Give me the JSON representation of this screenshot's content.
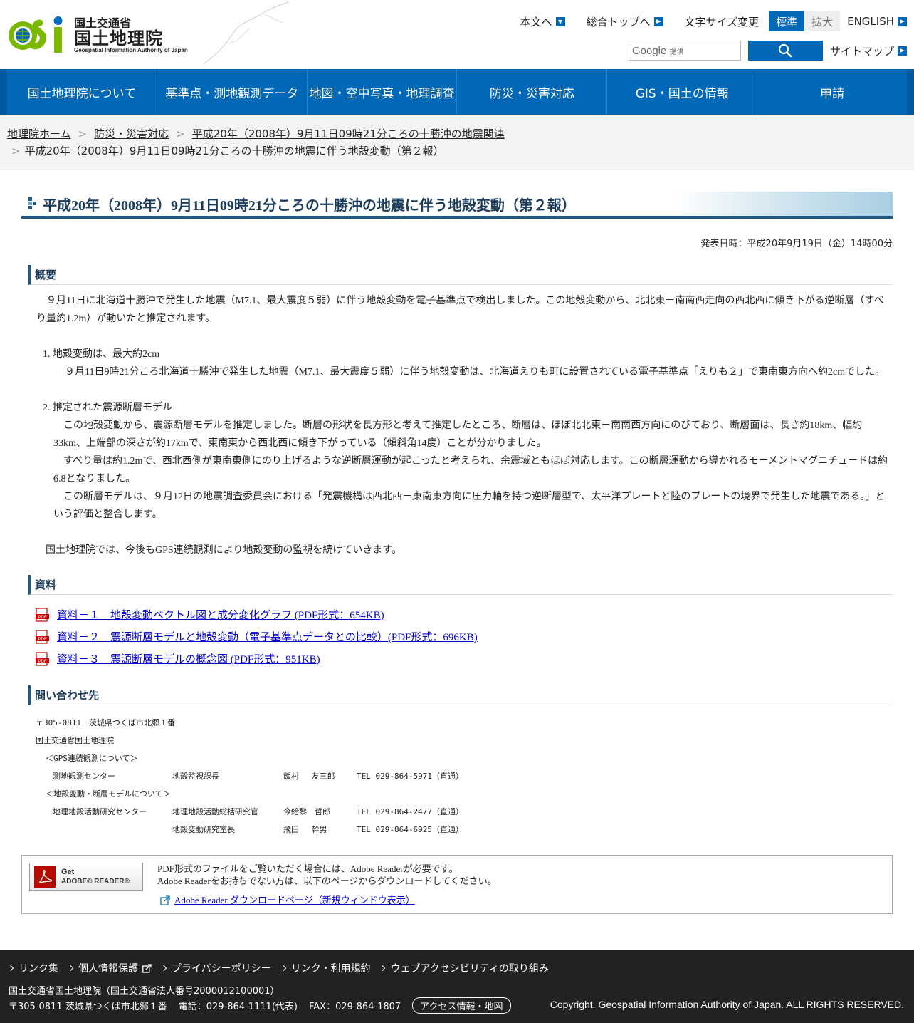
{
  "header": {
    "logo": {
      "org_small": "国土交通省",
      "org_main": "国土地理院",
      "org_en": "Geospatial Information Authority of Japan"
    },
    "links": {
      "to_content": "本文へ",
      "to_top": "総合トップへ",
      "font_size_label": "文字サイズ変更",
      "font_standard": "標準",
      "font_large": "拡大",
      "english": "ENGLISH",
      "sitemap": "サイトマップ"
    },
    "search": {
      "google": "Google",
      "provided": "提供"
    }
  },
  "gnav": [
    "国土地理院について",
    "基準点・測地観測データ",
    "地図・空中写真・地理調査",
    "防災・災害対応",
    "GIS・国土の情報",
    "申請"
  ],
  "breadcrumb": {
    "home": "地理院ホーム",
    "disaster": "防災・災害対応",
    "related": "平成20年（2008年）9月11日09時21分ころの十勝沖の地震関連",
    "current": "平成20年（2008年）9月11日09時21分ころの十勝沖の地震に伴う地殻変動（第２報）",
    "sep": ">"
  },
  "main": {
    "title": "平成20年（2008年）9月11日09時21分ころの十勝沖の地震に伴う地殻変動（第２報）",
    "pub_date": "発表日時：平成20年9月19日（金）14時00分",
    "summary_heading": "概要",
    "summary": "９月11日に北海道十勝沖で発生した地震（M7.1、最大震度５弱）に伴う地殻変動を電子基準点で検出しました。この地殻変動から、北北東－南南西走向の西北西に傾き下がる逆断層（すべり量約1.2m）が動いたと推定されます。",
    "item1_title": "1. 地殻変動は、最大約2cm",
    "item1_body": "９月11日9時21分ころ北海道十勝沖で発生した地震（M7.1、最大震度５弱）に伴う地殻変動は、北海道えりも町に設置されている電子基準点「えりも２」で東南東方向へ約2cmでした。",
    "item2_title": "2. 推定された震源断層モデル",
    "item2_p1": "この地殻変動から、震源断層モデルを推定しました。断層の形状を長方形と考えて推定したところ、断層は、ほぼ北北東－南南西方向にのびており、断層面は、長さ約18km、幅約33km、上端部の深さが約17kmで、東南東から西北西に傾き下がっている（傾斜角14度）ことが分かりました。",
    "item2_p2": "すべり量は約1.2mで、西北西側が東南東側にのり上げるような逆断層運動が起こったと考えられ、余震域ともほぼ対応します。この断層運動から導かれるモーメントマグニチュードは約6.8となりました。",
    "item2_p3": "この断層モデルは、９月12日の地震調査委員会における「発震機構は西北西－東南東方向に圧力軸を持つ逆断層型で、太平洋プレートと陸のプレートの境界で発生した地震である。」という評価と整合します。",
    "closing": "国土地理院では、今後もGPS連続観測により地殻変動の監視を続けていきます。",
    "resources_heading": "資料",
    "resources": [
      "資料－１　地殻変動ベクトル図と成分変化グラフ (PDF形式：654KB)",
      "資料－２　震源断層モデルと地殻変動（電子基準点データとの比較）(PDF形式：696KB)",
      "資料－３　震源断層モデルの概念図 (PDF形式：951KB)"
    ],
    "contact_heading": "問い合わせ先",
    "contact": {
      "address": "〒305-0811　茨城県つくば市北郷１番",
      "org": "国土交通省国土地理院",
      "gps_label": "＜GPS連続観測について＞",
      "gps_rows": [
        {
          "dept": "測地観測センター",
          "title": "地殻監視課長",
          "name": "飯村　 友三郎",
          "tel": "TEL 029-864-5971（直通）"
        }
      ],
      "fault_label": "＜地殻変動・断層モデルについて＞",
      "fault_rows": [
        {
          "dept": "地理地殻活動研究センター",
          "title": "地理地殻活動総括研究官",
          "name": "今給黎　哲郎",
          "tel": "TEL 029-864-2477（直通）"
        },
        {
          "dept": "",
          "title": "地殻変動研究室長",
          "name": "飛田　 幹男",
          "tel": "TEL 029-864-6925（直通）"
        }
      ]
    }
  },
  "adobe": {
    "badge_get": "Get",
    "badge_reader": "ADOBE® READER®",
    "line1": "PDF形式のファイルをご覧いただく場合には、Adobe Readerが必要です。",
    "line2": "Adobe Readerをお持ちでない方は、以下のページからダウンロードしてください。",
    "link": "Adobe Reader ダウンロードページ（新規ウィンドウ表示）"
  },
  "footer": {
    "links": [
      "リンク集",
      "個人情報保護",
      "プライバシーポリシー",
      "リンク・利用規約",
      "ウェブアクセシビリティの取り組み"
    ],
    "org": "国土交通省国土地理院（国土交通省法人番号2000012100001）",
    "address": "〒305-0811 茨城県つくば市北郷１番",
    "phone": "電話：029-864-1111(代表)",
    "fax": "FAX：029-864-1807",
    "access": "アクセス情報・地図",
    "copyright": "Copyright. Geospatial Information Authority of Japan. ALL RIGHTS RESERVED."
  },
  "colors": {
    "brand_blue": "#0068b7",
    "logo_green": "#7ab800",
    "footer_bg": "#222222"
  }
}
